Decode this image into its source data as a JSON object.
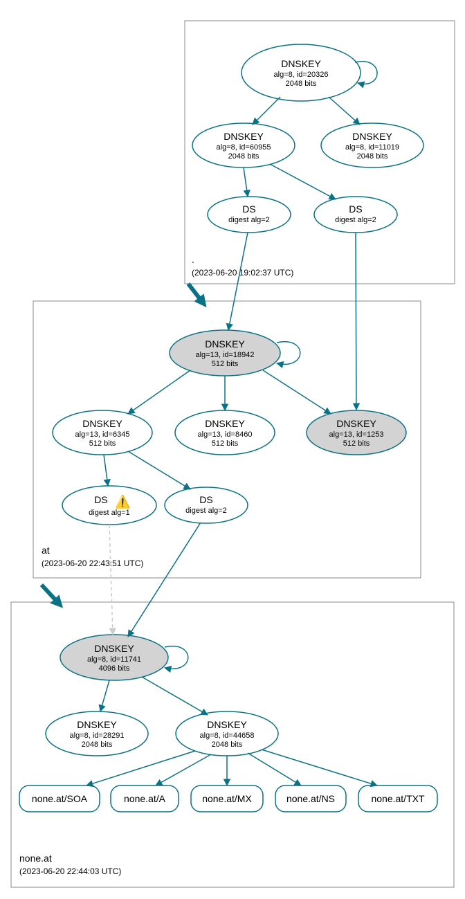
{
  "zones": {
    "root": {
      "label": ".",
      "timestamp": "(2023-06-20 19:02:37 UTC)",
      "nodes": {
        "dk_root": {
          "title": "DNSKEY",
          "line2": "alg=8, id=20326",
          "line3": "2048 bits"
        },
        "dk_60955": {
          "title": "DNSKEY",
          "line2": "alg=8, id=60955",
          "line3": "2048 bits"
        },
        "dk_11019": {
          "title": "DNSKEY",
          "line2": "alg=8, id=11019",
          "line3": "2048 bits"
        },
        "ds_a": {
          "title": "DS",
          "line2": "digest alg=2"
        },
        "ds_b": {
          "title": "DS",
          "line2": "digest alg=2"
        }
      }
    },
    "at": {
      "label": "at",
      "timestamp": "(2023-06-20 22:43:51 UTC)",
      "nodes": {
        "dk_18942": {
          "title": "DNSKEY",
          "line2": "alg=13, id=18942",
          "line3": "512 bits"
        },
        "dk_6345": {
          "title": "DNSKEY",
          "line2": "alg=13, id=6345",
          "line3": "512 bits"
        },
        "dk_8460": {
          "title": "DNSKEY",
          "line2": "alg=13, id=8460",
          "line3": "512 bits"
        },
        "dk_1253": {
          "title": "DNSKEY",
          "line2": "alg=13, id=1253",
          "line3": "512 bits"
        },
        "ds_warn": {
          "title": "DS",
          "line2": "digest alg=1",
          "warn": true
        },
        "ds_2": {
          "title": "DS",
          "line2": "digest alg=2"
        }
      }
    },
    "none_at": {
      "label": "none.at",
      "timestamp": "(2023-06-20 22:44:03 UTC)",
      "nodes": {
        "dk_11741": {
          "title": "DNSKEY",
          "line2": "alg=8, id=11741",
          "line3": "4096 bits"
        },
        "dk_28291": {
          "title": "DNSKEY",
          "line2": "alg=8, id=28291",
          "line3": "2048 bits"
        },
        "dk_44658": {
          "title": "DNSKEY",
          "line2": "alg=8, id=44658",
          "line3": "2048 bits"
        },
        "rr_soa": {
          "label": "none.at/SOA"
        },
        "rr_a": {
          "label": "none.at/A"
        },
        "rr_mx": {
          "label": "none.at/MX"
        },
        "rr_ns": {
          "label": "none.at/NS"
        },
        "rr_txt": {
          "label": "none.at/TXT"
        }
      }
    }
  }
}
